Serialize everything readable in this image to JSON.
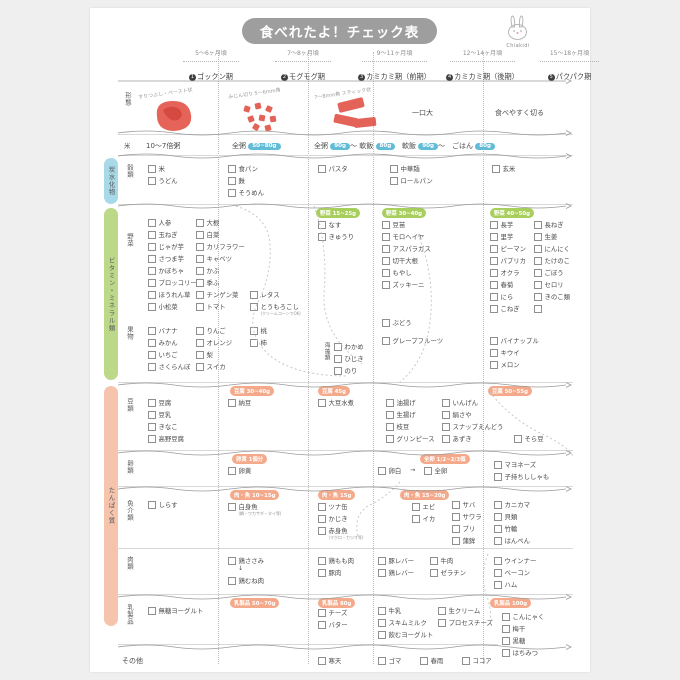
{
  "title": "食べれたよ！チェック表",
  "brand": "Chiakidi",
  "colors": {
    "blue": "#62bcd8",
    "green": "#a8cf5d",
    "orange": "#f4a98a",
    "gray": "#9e9e9e",
    "red": "#e0483c"
  },
  "stages": [
    {
      "num": "1",
      "age": "5〜6ヶ月頃",
      "name": "ゴックン期"
    },
    {
      "num": "2",
      "age": "7〜8ヶ月頃",
      "name": "モグモグ期"
    },
    {
      "num": "3",
      "age": "9〜11ヶ月頃",
      "name": "カミカミ期（前期）"
    },
    {
      "num": "4",
      "age": "12〜14ヶ月頃",
      "name": "カミカミ期（後期）"
    },
    {
      "num": "5",
      "age": "15〜18ヶ月頃",
      "name": "パクパク期"
    }
  ],
  "form_row": {
    "label": "形態",
    "captions": [
      "すりつぶし・ペースト状",
      "みじん切り 5〜6mm角",
      "7〜8mm角 スティック状",
      "一口大",
      "食べやすく切る"
    ]
  },
  "rice_row": {
    "label": "米",
    "cells": [
      {
        "text": "10〜7倍粥",
        "badge": ""
      },
      {
        "text": "全粥",
        "badge": "50~80g"
      },
      {
        "text": "全粥",
        "badge": "90g",
        "text2": "〜 軟飯",
        "badge2": "80g"
      },
      {
        "text": "軟飯",
        "badge": "90g",
        "text2": "〜　ごはん",
        "badge2": "80g"
      },
      {
        "text": "",
        "badge": ""
      }
    ]
  },
  "categories": [
    {
      "name": "炭水化物",
      "color": "#a7d9e8"
    },
    {
      "name": "ビタミン・ミネラル類",
      "color": "#bcd98a"
    },
    {
      "name": "たんぱく質",
      "color": "#f6c3ac"
    }
  ],
  "sections": [
    {
      "row_label": "穀類",
      "badges": [],
      "columns": [
        {
          "items": [
            {
              "t": "米"
            },
            {
              "t": "うどん"
            }
          ]
        },
        {
          "items": [
            {
              "t": "食パン"
            },
            {
              "t": "麩"
            },
            {
              "t": "そうめん"
            }
          ]
        },
        {
          "items": [
            {
              "t": "パスタ"
            }
          ]
        },
        {
          "items": [
            {
              "t": "中華麺"
            },
            {
              "t": "ロールパン"
            }
          ]
        },
        {
          "items": [
            {
              "t": "玄米"
            }
          ]
        }
      ]
    },
    {
      "row_label": "野菜",
      "badges": [
        {
          "col": 3,
          "text": "野菜 15~25g",
          "color": "#a8cf5d"
        },
        {
          "col": 4,
          "text": "野菜 30~40g",
          "color": "#a8cf5d"
        },
        {
          "col": 5,
          "text": "野菜 40~50g",
          "color": "#a8cf5d"
        }
      ],
      "columns": [
        {
          "items": [
            {
              "t": "人参"
            },
            {
              "t": "玉ねぎ"
            },
            {
              "t": "じゃが芋"
            },
            {
              "t": "さつま芋"
            },
            {
              "t": "かぼちゃ"
            },
            {
              "t": "ブロッコリー"
            },
            {
              "t": "ほうれん草"
            },
            {
              "t": "小松菜"
            }
          ]
        },
        {
          "items": [
            {
              "t": "大根"
            },
            {
              "t": "白菜"
            },
            {
              "t": "カリフラワー"
            },
            {
              "t": "キャベツ"
            },
            {
              "t": "かぶ"
            },
            {
              "t": "季ふ"
            },
            {
              "t": "チンゲン菜"
            },
            {
              "t": "トマト"
            }
          ]
        },
        {
          "items": [
            {
              "t": "なす"
            },
            {
              "t": "きゅうり"
            },
            {
              "t": "レタス"
            },
            {
              "t": "とうもろこし",
              "sub": "(クリームコーンでOK)"
            }
          ]
        },
        {
          "items": [
            {
              "t": "豆苗"
            },
            {
              "t": "モロヘイヤ"
            },
            {
              "t": "アスパラガス"
            },
            {
              "t": "切干大根"
            },
            {
              "t": "もやし"
            },
            {
              "t": "ズッキーニ"
            }
          ]
        },
        {
          "items": [
            {
              "t": "長芋"
            },
            {
              "t": "里芋"
            },
            {
              "t": "ピーマン"
            },
            {
              "t": "パプリカ"
            },
            {
              "t": "オクラ"
            },
            {
              "t": "春菊"
            },
            {
              "t": "にら"
            },
            {
              "t": "こねぎ"
            },
            {
              "t": "長ねぎ"
            },
            {
              "t": "生姜"
            },
            {
              "t": "にんにく"
            },
            {
              "t": "たけのこ"
            },
            {
              "t": "ごぼう"
            },
            {
              "t": "セロリ"
            },
            {
              "t": "きのこ類"
            }
          ]
        }
      ]
    },
    {
      "row_label": "果物",
      "badges": [],
      "columns": [
        {
          "items": [
            {
              "t": "バナナ"
            },
            {
              "t": "みかん"
            },
            {
              "t": "いちご"
            },
            {
              "t": "さくらんぼ"
            }
          ]
        },
        {
          "items": [
            {
              "t": "りんご"
            },
            {
              "t": "オレンジ"
            },
            {
              "t": "梨"
            },
            {
              "t": "スイカ"
            }
          ]
        },
        {
          "items": [
            {
              "t": "桃"
            },
            {
              "t": "柿"
            }
          ]
        },
        {
          "items": [
            {
              "t": "ぶどう"
            },
            {
              "t": "グレープフルーツ"
            }
          ]
        },
        {
          "items": [
            {
              "t": "パイナップル"
            },
            {
              "t": "キウイ"
            },
            {
              "t": "メロン"
            }
          ]
        }
      ],
      "seaweed": {
        "label": "海藻類",
        "items": [
          {
            "t": "わかめ"
          },
          {
            "t": "ひじき"
          },
          {
            "t": "のり"
          }
        ]
      }
    },
    {
      "row_label": "豆類",
      "badges": [
        {
          "col": 2,
          "text": "豆腐 30~40g",
          "color": "#f4a98a"
        },
        {
          "col": 3,
          "text": "豆腐 45g",
          "color": "#f4a98a"
        },
        {
          "col": 5,
          "text": "豆腐 50~55g",
          "color": "#f4a98a"
        }
      ],
      "columns": [
        {
          "items": [
            {
              "t": "豆腐"
            },
            {
              "t": "豆乳"
            },
            {
              "t": "きなこ"
            },
            {
              "t": "高野豆腐"
            }
          ]
        },
        {
          "items": [
            {
              "t": "納豆"
            }
          ]
        },
        {
          "items": [
            {
              "t": "大豆水煮"
            }
          ]
        },
        {
          "items": [
            {
              "t": "油揚げ"
            },
            {
              "t": "生揚げ"
            },
            {
              "t": "枝豆"
            },
            {
              "t": "グリンピース"
            },
            {
              "t": "いんげん"
            },
            {
              "t": "絹さや"
            },
            {
              "t": "スナップえんどう"
            },
            {
              "t": "あずき"
            }
          ]
        },
        {
          "items": [
            {
              "t": "そら豆"
            }
          ]
        }
      ]
    },
    {
      "row_label": "卵類",
      "badges": [
        {
          "col": 2,
          "text": "卵黄 1個分",
          "color": "#f4a98a"
        },
        {
          "col": 4,
          "text": "全卵 1/2~2/3個",
          "color": "#f4a98a"
        }
      ],
      "columns": [
        {
          "items": []
        },
        {
          "items": [
            {
              "t": "卵黄"
            }
          ]
        },
        {
          "items": []
        },
        {
          "items": [
            {
              "t": "卵白"
            },
            {
              "t": "全卵",
              "arrow": true
            }
          ]
        },
        {
          "items": [
            {
              "t": "マヨネーズ"
            },
            {
              "t": "子持ちししゃも"
            }
          ]
        }
      ]
    },
    {
      "row_label": "魚介類",
      "badges": [
        {
          "col": 2,
          "text": "肉・魚 10~15g",
          "color": "#f4a98a"
        },
        {
          "col": 3,
          "text": "肉・魚 15g",
          "color": "#f4a98a"
        },
        {
          "col": 4,
          "text": "肉・魚 15~20g",
          "color": "#f4a98a"
        }
      ],
      "columns": [
        {
          "items": [
            {
              "t": "しらす"
            }
          ]
        },
        {
          "items": [
            {
              "t": "白身魚",
              "sub": "(鯛・ワカサギ・タイ等)"
            }
          ]
        },
        {
          "items": [
            {
              "t": "ツナ缶"
            },
            {
              "t": "かじき"
            },
            {
              "t": "赤身魚",
              "sub": "(マグロ・カツオ等)"
            }
          ]
        },
        {
          "items": [
            {
              "t": "エビ"
            },
            {
              "t": "イカ"
            }
          ]
        },
        {
          "items": [
            {
              "t": "サバ"
            },
            {
              "t": "サワラ"
            },
            {
              "t": "ブリ"
            },
            {
              "t": "蒲鉾"
            },
            {
              "t": "カニカマ"
            },
            {
              "t": "貝類"
            },
            {
              "t": "竹輪"
            },
            {
              "t": "はんぺん"
            }
          ]
        }
      ]
    },
    {
      "row_label": "肉類",
      "badges": [],
      "columns": [
        {
          "items": []
        },
        {
          "items": [
            {
              "t": "鶏ささみ"
            },
            {
              "t": "鶏むね肉",
              "arrowdown": true
            }
          ]
        },
        {
          "items": [
            {
              "t": "鶏もも肉"
            },
            {
              "t": "豚肉"
            }
          ]
        },
        {
          "items": [
            {
              "t": "豚レバー"
            },
            {
              "t": "鶏レバー"
            },
            {
              "t": "牛肉"
            },
            {
              "t": "ゼラチン"
            }
          ]
        },
        {
          "items": [
            {
              "t": "ウインナー"
            },
            {
              "t": "ベーコン"
            },
            {
              "t": "ハム"
            }
          ]
        }
      ]
    },
    {
      "row_label": "乳製品",
      "badges": [
        {
          "col": 2,
          "text": "乳製品 50~70g",
          "color": "#f4a98a"
        },
        {
          "col": 3,
          "text": "乳製品 80g",
          "color": "#f4a98a"
        },
        {
          "col": 5,
          "text": "乳製品 100g",
          "color": "#f4a98a"
        }
      ],
      "columns": [
        {
          "items": [
            {
              "t": "無糖ヨーグルト"
            }
          ]
        },
        {
          "items": []
        },
        {
          "items": [
            {
              "t": "チーズ"
            },
            {
              "t": "バター"
            }
          ]
        },
        {
          "items": [
            {
              "t": "牛乳"
            },
            {
              "t": "スキムミルク"
            },
            {
              "t": "飲むヨーグルト"
            },
            {
              "t": "生クリーム"
            },
            {
              "t": "プロセスチーズ"
            }
          ]
        },
        {
          "items": [
            {
              "t": "こんにゃく"
            },
            {
              "t": "梅干"
            },
            {
              "t": "黒糖"
            },
            {
              "t": "はちみつ"
            }
          ]
        }
      ]
    },
    {
      "row_label": "その他",
      "badges": [],
      "columns": [
        {
          "items": []
        },
        {
          "items": []
        },
        {
          "items": [
            {
              "t": "寒天"
            }
          ]
        },
        {
          "items": [
            {
              "t": "ゴマ"
            },
            {
              "t": "春雨"
            },
            {
              "t": "ココア"
            }
          ]
        },
        {
          "items": []
        }
      ]
    }
  ]
}
